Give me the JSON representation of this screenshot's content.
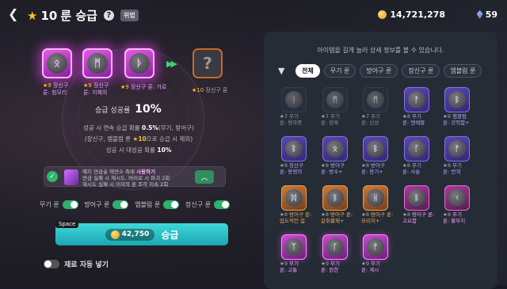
{
  "header": {
    "back": "❮",
    "star": "★",
    "title_level": "10",
    "title_text": "룬 승급",
    "help": "?",
    "badge": "위법",
    "gold": "14,721,278",
    "gems": "59"
  },
  "sources": [
    {
      "glyph": "ᛟ",
      "star": "★9",
      "name": "장신구",
      "sub": "룬: 힘모리"
    },
    {
      "glyph": "ᛗ",
      "star": "★9",
      "name": "장신구",
      "sub": "룬: 지혜의"
    },
    {
      "glyph": "ᚦ",
      "star": "★9",
      "name": "장신구 룬: 가로"
    }
  ],
  "target": {
    "glyph": "?",
    "star": "★10",
    "name": "장신구 룬"
  },
  "arrows": "▶▶",
  "success": {
    "label": "승급 성공률",
    "value": "10%"
  },
  "info": {
    "line1_a": "성공 시 연속 승급 확률 ",
    "line1_b": "0.5%",
    "line1_c": "(무기, 방어구)",
    "line2_a": "(장신구, 엠블럼 룬 ",
    "line2_b": "★10",
    "line2_c": "으로 승급 시 제외)",
    "line3_a": "성공 시 대성공 확률 ",
    "line3_b": "10%"
  },
  "boost": {
    "check": "✓",
    "title_a": "예지 연금술 재연소 촉매 ",
    "title_b": "사용하기",
    "line2": "연금 실패 시 재시도, 머러로 시 파괴 2회",
    "line3": "재시도 실패 시 이자의 룬 조각 지속 2회",
    "chevron": "︿"
  },
  "toggles": [
    {
      "label": "무기 룬",
      "on": true
    },
    {
      "label": "방어구 룬",
      "on": true
    },
    {
      "label": "엠블럼 룬",
      "on": true
    },
    {
      "label": "장신구 룬",
      "on": true
    }
  ],
  "upgrade": {
    "space": "Space",
    "cost": "42,750",
    "label": "승급"
  },
  "auto": {
    "label": "재료 자동 넣기"
  },
  "panel": {
    "hint": "아이템을 길게 눌러 상세 정보를 볼 수 있습니다.",
    "filter_icon": "▼",
    "tabs": [
      "전체",
      "무기 룬",
      "방어구 룬",
      "장신구 룬",
      "엠블럼 룬"
    ]
  },
  "grid": [
    {
      "glyph": "ᛁ",
      "cls": "dim",
      "lc": "",
      "star": "★7",
      "l1": "무기",
      "l2": "룬: 용마증"
    },
    {
      "glyph": "ᛗ",
      "cls": "dim",
      "lc": "",
      "star": "★7",
      "l1": "무기",
      "l2": "룬: 암록"
    },
    {
      "glyph": "ᛗ",
      "cls": "dim",
      "lc": "",
      "star": "★7",
      "l1": "무기",
      "l2": "룬: 신성"
    },
    {
      "glyph": "ᚨ",
      "cls": "purple",
      "lc": "pp",
      "star": "★8",
      "l1": "무기",
      "l2": "룬: 엔쉐블"
    },
    {
      "glyph": "ᛒ",
      "cls": "purple",
      "lc": "pp",
      "star": "★8",
      "l1": "엠블럼",
      "l2": "룬: 강력함+"
    },
    {
      "glyph": "ᛒ",
      "cls": "purple",
      "lc": "pp",
      "star": "★8",
      "l1": "장신구",
      "l2": "룬: 용맹의"
    },
    {
      "glyph": "ᛟ",
      "cls": "purple",
      "lc": "pp",
      "star": "★8",
      "l1": "방어구",
      "l2": "룬: 방수+"
    },
    {
      "glyph": "ᛒ",
      "cls": "purple",
      "lc": "pp",
      "star": "★8",
      "l1": "방어구",
      "l2": "룬: 용기+"
    },
    {
      "glyph": "ᚴ",
      "cls": "purple",
      "lc": "pp",
      "star": "★8",
      "l1": "무기",
      "l2": "룬: 사슬"
    },
    {
      "glyph": "ᚠ",
      "cls": "purple",
      "lc": "pp",
      "star": "★8",
      "l1": "무기",
      "l2": "룬: 번개"
    },
    {
      "glyph": "ᛞ",
      "cls": "orange",
      "lc": "or",
      "star": "★8",
      "l1": "방어구 룬:",
      "l2": "업도적인 힘"
    },
    {
      "glyph": "ᛒ",
      "cls": "orange",
      "lc": "or",
      "star": "★8",
      "l1": "방어구 룬:",
      "l2": "갈취황제+"
    },
    {
      "glyph": "ᚺ",
      "cls": "orange",
      "lc": "or",
      "star": "★8",
      "l1": "방어구 룬:",
      "l2": "모리지+"
    },
    {
      "glyph": "ᛒ",
      "cls": "magenta",
      "lc": "pk",
      "star": "★8",
      "l1": "방어구 룬:",
      "l2": "고요함"
    },
    {
      "glyph": "ᚲ",
      "cls": "magenta",
      "lc": "pk",
      "star": "★8",
      "l1": "무기",
      "l2": "룬: 황무지"
    },
    {
      "glyph": "ᛉ",
      "cls": "pink",
      "lc": "pk",
      "star": "★9",
      "l1": "무기",
      "l2": "룬: 고통"
    },
    {
      "glyph": "ᚴ",
      "cls": "pink",
      "lc": "pk",
      "star": "★9",
      "l1": "무기",
      "l2": "룬: 원한"
    },
    {
      "glyph": "ᚠ",
      "cls": "pink",
      "lc": "pk",
      "star": "★9",
      "l1": "무기",
      "l2": "룬: 계시"
    }
  ]
}
